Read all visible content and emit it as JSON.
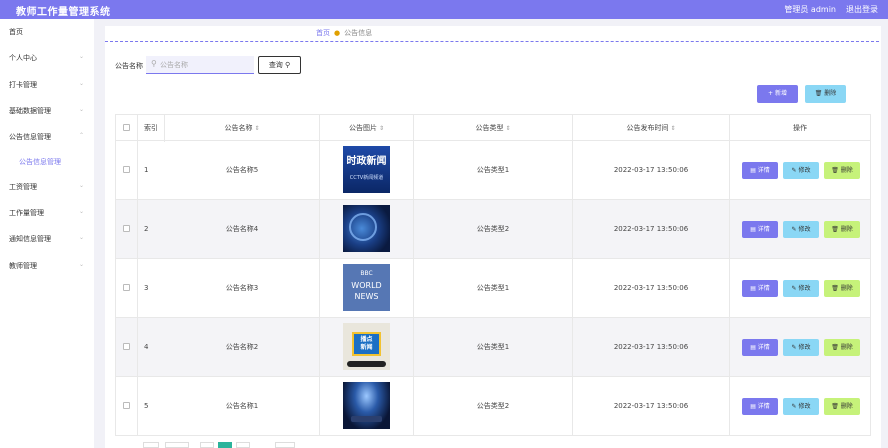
{
  "header": {
    "title": "教师工作量管理系统",
    "user": "管理员 admin",
    "logout": "退出登录"
  },
  "sidebar": {
    "items": [
      {
        "label": "首页",
        "arrow": ""
      },
      {
        "label": "个人中心",
        "arrow": "⌄"
      },
      {
        "label": "打卡管理",
        "arrow": "⌄"
      },
      {
        "label": "基础数据管理",
        "arrow": "⌄"
      },
      {
        "label": "公告信息管理",
        "arrow": "⌃"
      },
      {
        "label": "公告信息管理",
        "arrow": ""
      },
      {
        "label": "工资管理",
        "arrow": "⌄"
      },
      {
        "label": "工作量管理",
        "arrow": "⌄"
      },
      {
        "label": "通知信息管理",
        "arrow": "⌄"
      },
      {
        "label": "教师管理",
        "arrow": "⌄"
      }
    ]
  },
  "breadcrumb": {
    "home": "首页",
    "current": "公告信息"
  },
  "search": {
    "label": "公告名称",
    "placeholder": "公告名称",
    "button": "查询"
  },
  "actions": {
    "add": "新增",
    "delete": "删除"
  },
  "table": {
    "headers": {
      "index": "索引",
      "name": "公告名称",
      "image": "公告图片",
      "type": "公告类型",
      "time": "公告发布时间",
      "ops": "操作"
    },
    "ops": {
      "detail": "详情",
      "edit": "修改",
      "delete": "删除"
    },
    "rows": [
      {
        "index": "1",
        "name": "公告名称5",
        "type": "公告类型1",
        "time": "2022-03-17 13:50:06",
        "img_text": "时政新闻",
        "img_sub": "CCTV新闻频道"
      },
      {
        "index": "2",
        "name": "公告名称4",
        "type": "公告类型2",
        "time": "2022-03-17 13:50:06",
        "img_text": "",
        "img_sub": ""
      },
      {
        "index": "3",
        "name": "公告名称3",
        "type": "公告类型1",
        "time": "2022-03-17 13:50:06",
        "img_text": "WORLD",
        "img_sub": "NEWS",
        "img_badge": "BBC"
      },
      {
        "index": "4",
        "name": "公告名称2",
        "type": "公告类型1",
        "time": "2022-03-17 13:50:06",
        "img_text": "播点",
        "img_sub": "新闻"
      },
      {
        "index": "5",
        "name": "公告名称1",
        "type": "公告类型2",
        "time": "2022-03-17 13:50:06",
        "img_text": "",
        "img_sub": ""
      }
    ]
  },
  "colors": {
    "primary": "#7b78ee",
    "info": "#8ad7f5",
    "success": "#c6f27a",
    "pagerActive": "#2bb39b"
  },
  "icons": {
    "search": "search-icon",
    "add": "plus-icon",
    "delete": "trash-icon",
    "detail": "document-icon",
    "edit": "edit-icon",
    "sort": "sort-icon"
  }
}
